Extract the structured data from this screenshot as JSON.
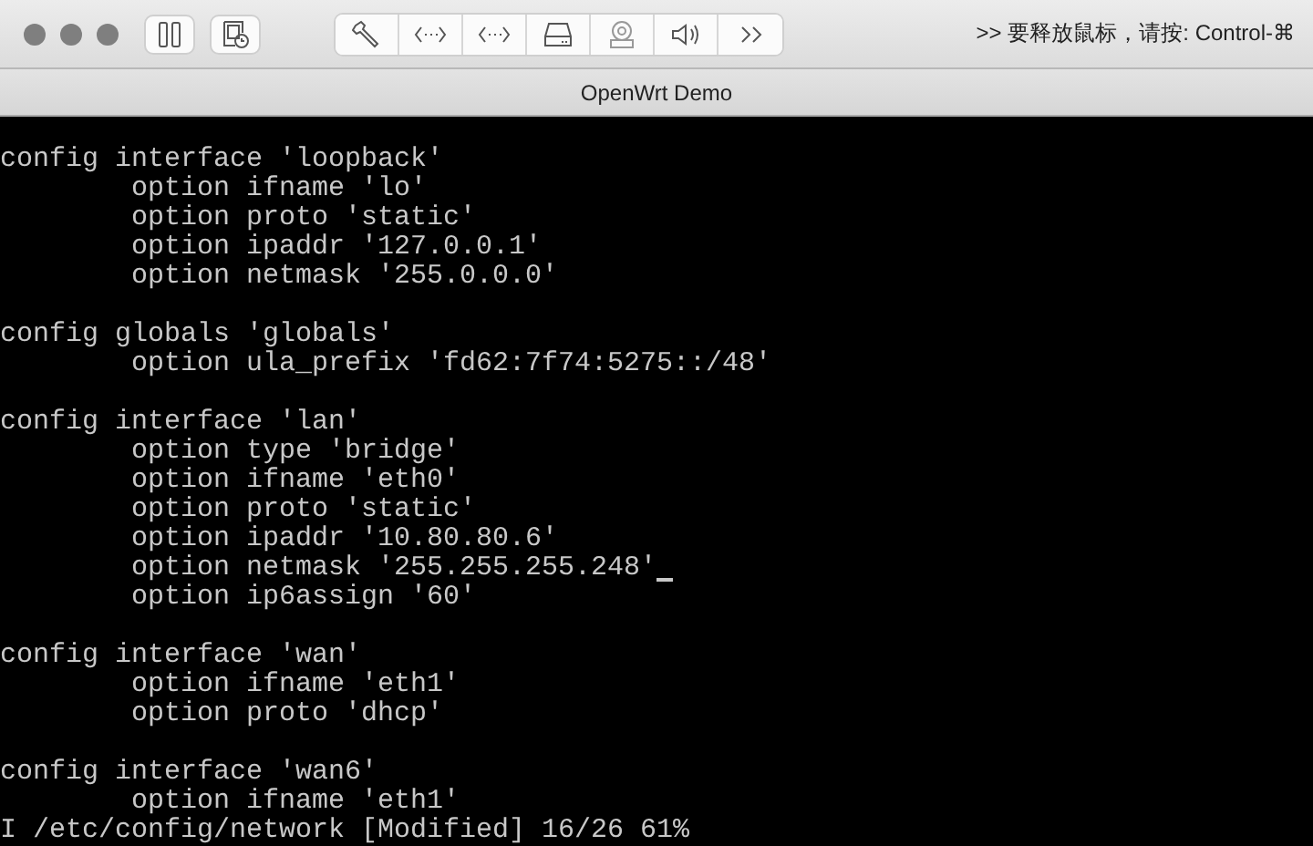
{
  "window": {
    "title": "OpenWrt Demo"
  },
  "toolbar": {
    "hint": ">> 要释放鼠标，请按: Control-⌘"
  },
  "terminal": {
    "blocks": [
      {
        "header": "config interface 'loopback'",
        "options": [
          {
            "text": "option ifname 'lo'",
            "cursor": false
          },
          {
            "text": "option proto 'static'",
            "cursor": false
          },
          {
            "text": "option ipaddr '127.0.0.1'",
            "cursor": false
          },
          {
            "text": "option netmask '255.0.0.0'",
            "cursor": false
          }
        ]
      },
      {
        "header": "config globals 'globals'",
        "options": [
          {
            "text": "option ula_prefix 'fd62:7f74:5275::/48'",
            "cursor": false
          }
        ]
      },
      {
        "header": "config interface 'lan'",
        "options": [
          {
            "text": "option type 'bridge'",
            "cursor": false
          },
          {
            "text": "option ifname 'eth0'",
            "cursor": false
          },
          {
            "text": "option proto 'static'",
            "cursor": false
          },
          {
            "text": "option ipaddr '10.80.80.6'",
            "cursor": false
          },
          {
            "text": "option netmask '255.255.255.248'",
            "cursor": true
          },
          {
            "text": "option ip6assign '60'",
            "cursor": false
          }
        ]
      },
      {
        "header": "config interface 'wan'",
        "options": [
          {
            "text": "option ifname 'eth1'",
            "cursor": false
          },
          {
            "text": "option proto 'dhcp'",
            "cursor": false
          }
        ]
      },
      {
        "header": "config interface 'wan6'",
        "options": [
          {
            "text": "option ifname 'eth1'",
            "cursor": false
          }
        ]
      }
    ],
    "status_line": "I /etc/config/network [Modified] 16/26 61%"
  }
}
